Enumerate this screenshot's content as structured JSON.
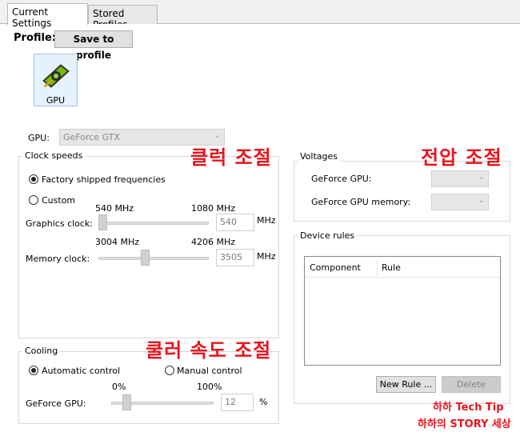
{
  "tabs": {
    "current": "Current Settings",
    "stored": "Stored Profiles"
  },
  "profile": {
    "label": "Profile:",
    "save_button": "Save to profile"
  },
  "gpu_tile": {
    "label": "GPU"
  },
  "gpu_select": {
    "label": "GPU:",
    "value": "GeForce GTX"
  },
  "clock": {
    "title": "Clock speeds",
    "factory_label": "Factory shipped frequencies",
    "factory_checked": true,
    "custom_label": "Custom",
    "custom_checked": false,
    "graphics": {
      "label": "Graphics clock:",
      "min": "540 MHz",
      "max": "1080 MHz",
      "value": "540",
      "unit": "MHz",
      "level": 0
    },
    "memory": {
      "label": "Memory clock:",
      "min": "3004 MHz",
      "max": "4206 MHz",
      "value": "3505",
      "unit": "MHz",
      "level": 0.42
    }
  },
  "cooling": {
    "title": "Cooling",
    "auto_label": "Automatic control",
    "auto_checked": true,
    "manual_label": "Manual control",
    "manual_checked": false,
    "fan": {
      "label": "GeForce GPU:",
      "min": "0%",
      "max": "100%",
      "value": "12",
      "unit": "%",
      "level": 0.12
    }
  },
  "voltages": {
    "title": "Voltages",
    "gpu_label": "GeForce GPU:",
    "memory_label": "GeForce GPU memory:"
  },
  "device_rules": {
    "title": "Device rules",
    "columns": [
      "Component",
      "Rule"
    ],
    "new_rule_button": "New Rule ...",
    "delete_button": "Delete"
  },
  "annotations": {
    "clock": "클럭 조절",
    "voltage": "전압 조절",
    "fan": "쿨러 속도 조절"
  },
  "watermark": {
    "line1": "하하 Tech Tip",
    "line2": "하하의 STORY 세상"
  },
  "colors": {
    "annotation": "#e8141b",
    "gpu_icon_green": "#76b900",
    "selection": "#e5f1fb"
  }
}
